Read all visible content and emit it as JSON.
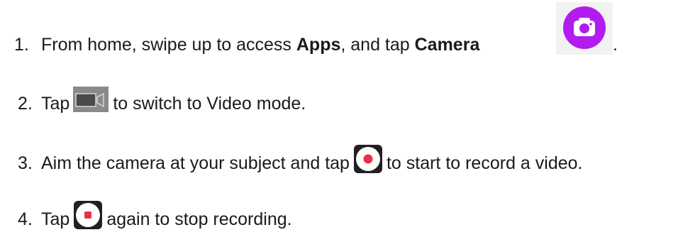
{
  "steps": [
    {
      "number": "1.",
      "before": "From home, swipe up to access ",
      "bold1": "Apps",
      "middle": ", and tap ",
      "bold2": "Camera",
      "after": "."
    },
    {
      "number": "2.",
      "before": "Tap",
      "after": "to switch to Video mode."
    },
    {
      "number": "3.",
      "before": "Aim the camera at your subject and tap",
      "after": "to start to record a video."
    },
    {
      "number": "4.",
      "before": "Tap",
      "after": "again to stop recording."
    }
  ],
  "icons": {
    "camera_app": "camera-app-icon",
    "video_mode": "video-mode-icon",
    "record": "record-start-icon",
    "stop": "record-stop-icon"
  },
  "colors": {
    "camera_app_purple": "#b21cf0",
    "record_red": "#e8324a",
    "button_dark": "#202020",
    "video_icon_gray": "#8a8a8a"
  }
}
